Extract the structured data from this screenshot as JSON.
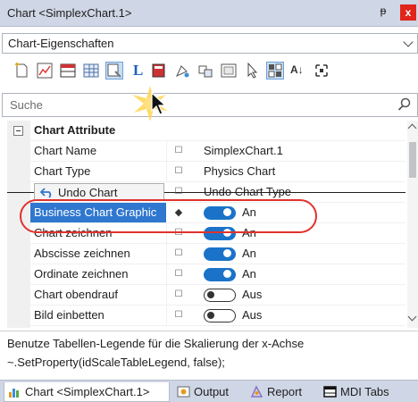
{
  "window": {
    "title": "Chart <SimplexChart.1>",
    "pin_glyph": "ᵽ",
    "close_glyph": "x"
  },
  "selector": {
    "value": "Chart-Eigenschaften"
  },
  "toolbar": {
    "icons": [
      "new-icon",
      "chart-icon",
      "table-icon",
      "grid-icon",
      "properties-icon",
      "L-icon",
      "book-icon",
      "paint-icon",
      "link-icon",
      "image-icon",
      "cursor-icon",
      "layout-icon",
      "sort-icon",
      "expand-icon"
    ],
    "L_glyph": "L",
    "sort_glyph": "A↓"
  },
  "search": {
    "placeholder": "Suche"
  },
  "grid": {
    "category": "Chart Attribute",
    "rows": [
      {
        "name": "Chart Name",
        "value": "SimplexChart.1"
      },
      {
        "name": "Chart Type",
        "value": "Physics Chart"
      },
      {
        "name": "Undo Chart",
        "value": "Undo Chart Type"
      },
      {
        "name": "Business Chart Graphic",
        "value": "An",
        "state": true
      },
      {
        "name": "Chart zeichnen",
        "value": "An",
        "state": true
      },
      {
        "name": "Abscisse zeichnen",
        "value": "An",
        "state": true
      },
      {
        "name": "Ordinate zeichnen",
        "value": "An",
        "state": true
      },
      {
        "name": "Chart obendrauf",
        "value": "Aus",
        "state": false
      },
      {
        "name": "Bild einbetten",
        "value": "Aus",
        "state": false
      }
    ]
  },
  "description": {
    "line1": "Benutze Tabellen-Legende für die Skalierung der x-Achse",
    "line2": "~.SetProperty(idScaleTableLegend, false);"
  },
  "tabs": [
    {
      "label": "Chart <SimplexChart.1>",
      "icon": "chart-tab-icon"
    },
    {
      "label": "Output",
      "icon": "output-icon"
    },
    {
      "label": "Report",
      "icon": "report-icon"
    },
    {
      "label": "MDI Tabs",
      "icon": "mdi-tabs-icon"
    }
  ],
  "colors": {
    "accent": "#1a73c9",
    "selection": "#2f77cf",
    "highlight": "#e0322d",
    "titlebar": "#cfd6e5"
  }
}
